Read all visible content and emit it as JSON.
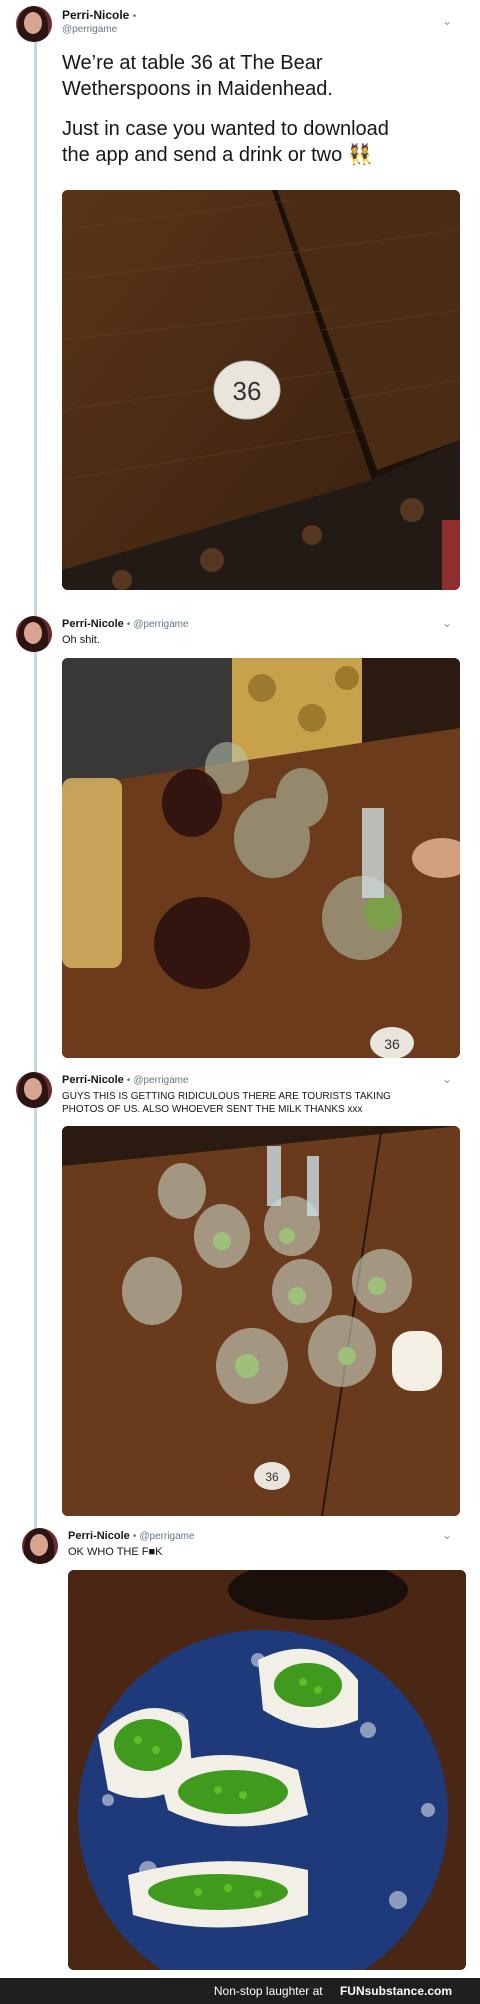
{
  "tweets": [
    {
      "name": "Perri-Nicole",
      "handle": "@perrigame",
      "text_line1": "We’re at table 36 at The Bear",
      "text_line2": "Wetherspoons in Maidenhead.",
      "text_line3": "Just in case you wanted to download",
      "text_line4": "the app and send a drink or two 👯",
      "photo_label": "36"
    },
    {
      "name": "Perri-Nicole",
      "handle": "@perrigame",
      "text": "Oh shit.",
      "photo_label": "36"
    },
    {
      "name": "Perri-Nicole",
      "handle": "@perrigame",
      "text_line1": "GUYS THIS IS GETTING RIDICULOUS THERE ARE TOURISTS TAKING",
      "text_line2": "PHOTOS OF US. ALSO WHOEVER SENT THE MILK THANKS xxx",
      "photo_label": "36"
    },
    {
      "name": "Perri-Nicole",
      "handle": "@perrigame",
      "text": "OK WHO THE F■K"
    }
  ],
  "footer": {
    "text": "Non-stop laughter at",
    "brand": "FUNsubstance.com"
  },
  "icons": {
    "chevron": "chevron-down-icon",
    "separator": "•"
  }
}
